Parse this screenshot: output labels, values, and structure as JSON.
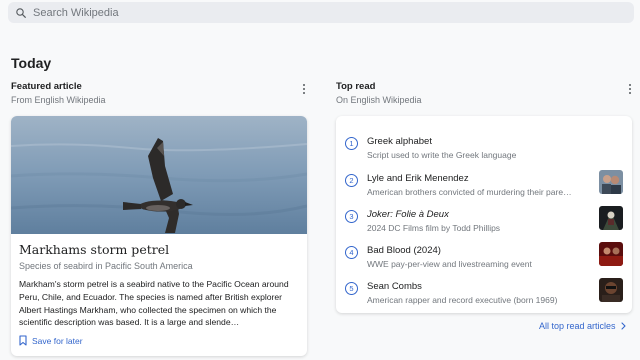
{
  "search": {
    "placeholder": "Search Wikipedia"
  },
  "today": {
    "heading": "Today"
  },
  "featured": {
    "title": "Featured article",
    "subtitle": "From English Wikipedia",
    "article_title": "Markhams storm petrel",
    "description": "Species of seabird in Pacific South America",
    "extract": "Markham's storm petrel is a seabird native to the Pacific Ocean around Peru, Chile, and Ecuador. The species is named after British explorer Albert Hastings Markham, who collected the specimen on which the scientific description was based. It is a large and slende…",
    "save_label": "Save for later"
  },
  "top_read": {
    "title": "Top read",
    "subtitle": "On English Wikipedia",
    "items": [
      {
        "rank": "1",
        "title": "Greek alphabet",
        "description": "Script used to write the Greek language",
        "thumbnail": ""
      },
      {
        "rank": "2",
        "title": "Lyle and Erik Menendez",
        "description": "American brothers convicted of murdering their pare…",
        "thumbnail": "menendez-photo"
      },
      {
        "rank": "3",
        "title": "Joker: Folie à Deux",
        "description": "2024 DC Films film by Todd Phillips",
        "thumbnail": "joker-poster"
      },
      {
        "rank": "4",
        "title": "Bad Blood (2024)",
        "description": "WWE pay-per-view and livestreaming event",
        "thumbnail": "bad-blood-poster"
      },
      {
        "rank": "5",
        "title": "Sean Combs",
        "description": "American rapper and record executive (born 1969)",
        "thumbnail": "sean-combs-photo"
      }
    ],
    "all_link": "All top read articles"
  },
  "colors": {
    "accent": "#3366cc",
    "background": "#f8f9fa",
    "card": "#ffffff",
    "muted_text": "#72777d"
  }
}
